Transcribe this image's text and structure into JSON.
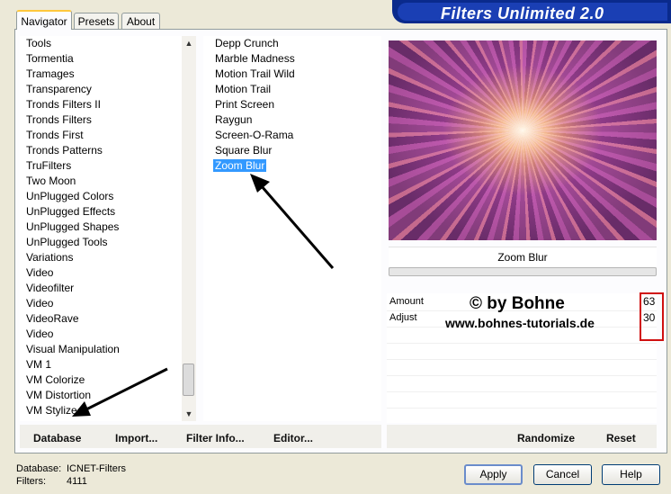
{
  "banner": {
    "title": "Filters Unlimited 2.0"
  },
  "tabs": [
    {
      "label": "Navigator",
      "active": true
    },
    {
      "label": "Presets",
      "active": false
    },
    {
      "label": "About",
      "active": false
    }
  ],
  "categories": [
    "Tools",
    "Tormentia",
    "Tramages",
    "Transparency",
    "Tronds Filters II",
    "Tronds Filters",
    "Tronds First",
    "Tronds Patterns",
    "TruFilters",
    "Two Moon",
    "UnPlugged Colors",
    "UnPlugged Effects",
    "UnPlugged Shapes",
    "UnPlugged Tools",
    "Variations",
    "Video",
    "Videofilter",
    "Video",
    "VideoRave",
    "Video",
    "Visual Manipulation",
    "VM 1",
    "VM Colorize",
    "VM Distortion",
    "VM Stylize"
  ],
  "filters": [
    {
      "label": "Depp Crunch",
      "selected": false
    },
    {
      "label": "Marble Madness",
      "selected": false
    },
    {
      "label": "Motion Trail Wild",
      "selected": false
    },
    {
      "label": "Motion Trail",
      "selected": false
    },
    {
      "label": "Print Screen",
      "selected": false
    },
    {
      "label": "Raygun",
      "selected": false
    },
    {
      "label": "Screen-O-Rama",
      "selected": false
    },
    {
      "label": "Square Blur",
      "selected": false
    },
    {
      "label": "Zoom Blur",
      "selected": true
    }
  ],
  "preview": {
    "filter_name": "Zoom Blur"
  },
  "params": [
    {
      "label": "Amount",
      "value": "63"
    },
    {
      "label": "Adjust",
      "value": "30"
    }
  ],
  "watermark": {
    "copyright": "© by Bohne",
    "website": "www.bohnes-tutorials.de"
  },
  "bottom_left_buttons": {
    "database": "Database",
    "import": "Import...",
    "filter_info": "Filter Info...",
    "editor": "Editor..."
  },
  "bottom_right_buttons": {
    "randomize": "Randomize",
    "reset": "Reset"
  },
  "status": {
    "database_label": "Database:",
    "database_value": "ICNET-Filters",
    "filters_label": "Filters:",
    "filters_value": "4111"
  },
  "dialog_buttons": {
    "apply": "Apply",
    "cancel": "Cancel",
    "help": "Help"
  },
  "colors": {
    "selection": "#3399ff",
    "banner": "#1a3fb4",
    "highlight_box": "#d01010"
  }
}
